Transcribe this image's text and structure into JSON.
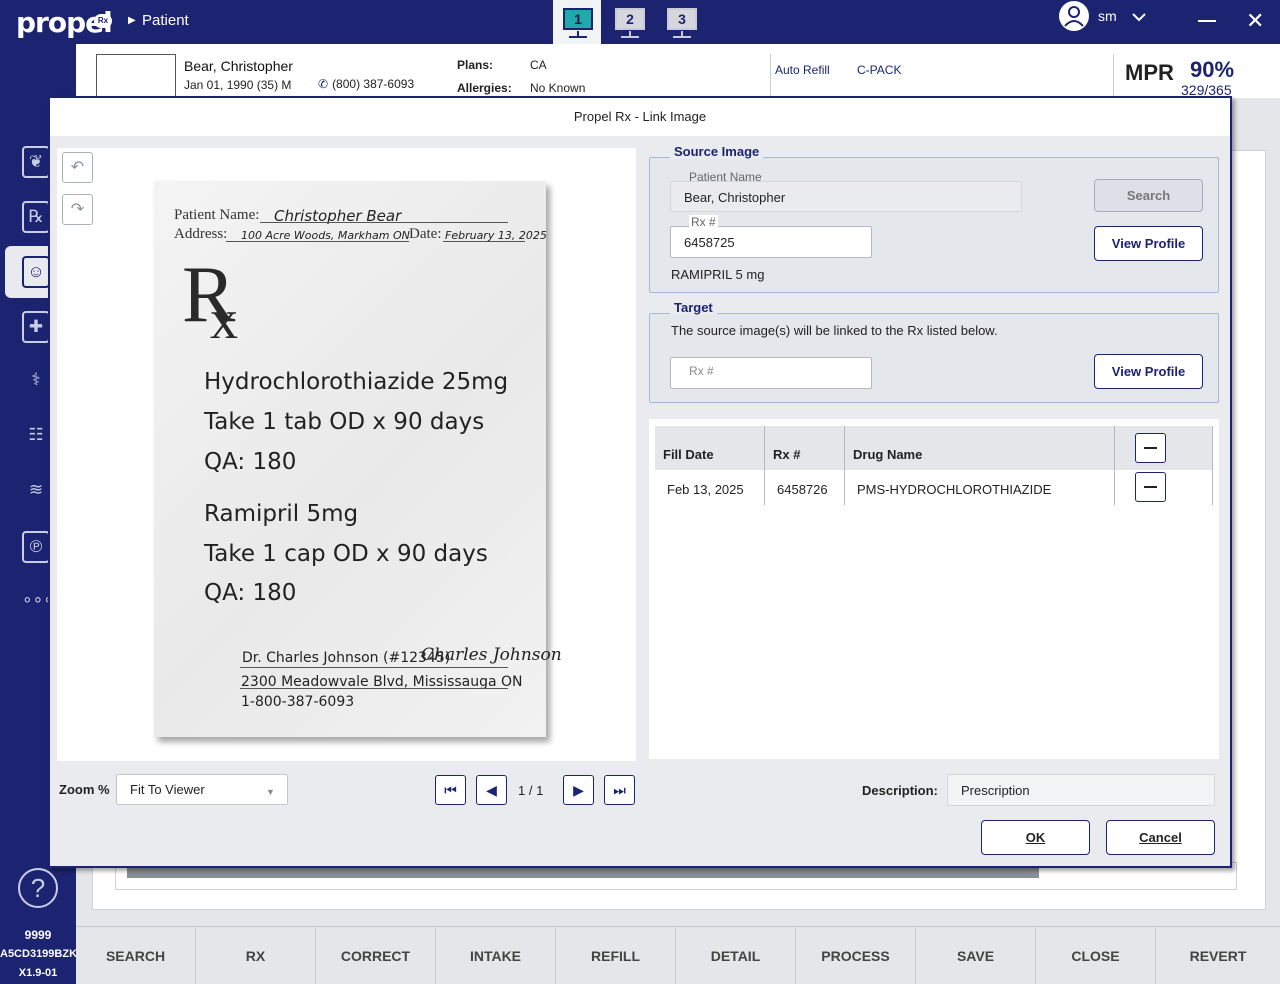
{
  "app": {
    "logo": "propel",
    "logo_badge": "Rx",
    "breadcrumb": "Patient"
  },
  "workstations": [
    "1",
    "2",
    "3"
  ],
  "user": {
    "initials": "sm"
  },
  "sidebar": {
    "store_number": "9999",
    "terminal_id": "A5CD3199BZK",
    "version": "X1.9-01"
  },
  "patient": {
    "name": "Bear, Christopher",
    "dob_line": "Jan 01, 1990 (35) M",
    "phone": "(800) 387-6093",
    "plans_label": "Plans:",
    "plans_value": "CA",
    "allergies_label": "Allergies:",
    "allergies_value": "No Known",
    "auto_refill": "Auto Refill",
    "cpack": "C-PACK",
    "mpr_label": "MPR",
    "mpr_pct": "90%",
    "mpr_fraction": "329/365"
  },
  "dialog": {
    "title": "Propel Rx - Link Image",
    "prescription": {
      "patient_label": "Patient Name:",
      "patient_value": "Christopher Bear",
      "address_label": "Address:",
      "address_value": "100 Acre Woods, Markham ON",
      "date_label": "Date:",
      "date_value": "February 13, 2025",
      "rx_symbol": "R",
      "rx_symbol_x": "x",
      "lines": [
        "Hydrochlorothiazide 25mg",
        "Take 1 tab OD x 90 days",
        "QA: 180",
        "Ramipril 5mg",
        "Take 1 cap OD x 90 days",
        "QA: 180"
      ],
      "doctor": "Dr. Charles Johnson (#12345)",
      "signature": "Charles Johnson",
      "doctor_address": "2300 Meadowvale Blvd, Mississauga ON",
      "doctor_phone": "1-800-387-6093"
    },
    "zoom_label": "Zoom %",
    "zoom_value": "Fit To Viewer",
    "page_indicator": "1 / 1",
    "source": {
      "legend": "Source Image",
      "patient_name_label": "Patient Name",
      "patient_name_value": "Bear, Christopher",
      "search_label": "Search",
      "rx_label": "Rx #",
      "rx_value": "6458725",
      "view_profile_label": "View Profile",
      "drug": "RAMIPRIL 5 mg"
    },
    "target": {
      "legend": "Target",
      "description": "The source image(s) will be linked to the Rx listed below.",
      "rx_placeholder": "Rx #",
      "view_profile_label": "View Profile"
    },
    "table": {
      "headers": [
        "Fill Date",
        "Rx #",
        "Drug Name"
      ],
      "rows": [
        {
          "fill_date": "Feb 13, 2025",
          "rx": "6458726",
          "drug": "PMS-HYDROCHLOROTHIAZIDE"
        }
      ]
    },
    "description_label": "Description:",
    "description_value": "Prescription",
    "ok_label": "OK",
    "cancel_label": "Cancel"
  },
  "bottom_bar": [
    "SEARCH",
    "RX",
    "CORRECT",
    "INTAKE",
    "REFILL",
    "DETAIL",
    "PROCESS",
    "SAVE",
    "CLOSE",
    "REVERT"
  ]
}
